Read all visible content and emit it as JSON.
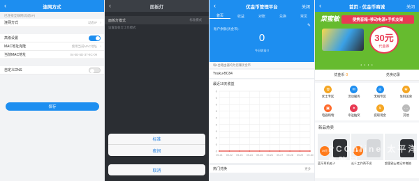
{
  "panel1": {
    "title": "连网方式",
    "hint": "已连接互联网(动态IP)",
    "connection": {
      "label": "连网方式",
      "value": "动态IP"
    },
    "advanced": {
      "label": "高级设置",
      "on": true
    },
    "mac_clone": {
      "label": "MAC地址克隆",
      "value": "使用当前MAC地址"
    },
    "mac_current": {
      "label": "当前MAC地址",
      "value": "04-0E-5D-37-8C-09"
    },
    "custom_dns": {
      "label": "自定义DNS",
      "on": false
    },
    "save_label": "保存"
  },
  "panel2": {
    "title": "面板灯",
    "mode": {
      "label": "面板灯模式",
      "value": "标准模式"
    },
    "hint": "设置面板灯工作模式",
    "options": [
      "标准",
      "夜间"
    ],
    "cancel_label": "取消"
  },
  "panel3": {
    "title": "优金币管理平台",
    "close_label": "关闭",
    "tabs": [
      "首页",
      "收益",
      "对账",
      "兑换",
      "常见"
    ],
    "balance_label": "账户余额(优金币):",
    "balance_value": "0",
    "balance_sub": "今日收益 0",
    "note": "每1台路由器均为您赚优金币",
    "device": "Youku-BC84",
    "chart_title": "最近10天收益",
    "hot_label": "热门兑换",
    "more_label": "更多"
  },
  "panel4": {
    "title": "首页 - 优金币商城",
    "close_label": "关闭",
    "banner": {
      "brand": "菜蜜敏",
      "tagline": "便携音箱+移动电源+手机支架",
      "coupon_value": "30元",
      "coupon_unit": "代金券"
    },
    "coin_label": "优金币",
    "coin_value": "0",
    "exchange_label": "兑换记录",
    "grid": [
      {
        "label": "优土专区",
        "icon": "shield-icon",
        "color": "#f5a623",
        "glyph": "✿"
      },
      {
        "label": "活动服务",
        "icon": "chat-icon",
        "color": "#1d8ef0",
        "glyph": "✉"
      },
      {
        "label": "无线专区",
        "icon": "wifi-icon",
        "color": "#1d8ef0",
        "glyph": "◎"
      },
      {
        "label": "生鲜美食",
        "icon": "food-icon",
        "color": "#f5a623",
        "glyph": "❀"
      },
      {
        "label": "电器购物",
        "icon": "bag-icon",
        "color": "#ff6a2b",
        "glyph": "▣"
      },
      {
        "label": "幸运抽奖",
        "icon": "gift-icon",
        "color": "#e83a53",
        "glyph": "✦"
      },
      {
        "label": "提取现金",
        "icon": "cash-icon",
        "color": "#f5a623",
        "glyph": "¥"
      },
      {
        "label": "其他",
        "icon": "more-icon",
        "color": "#bbbbbb",
        "glyph": "⋯"
      }
    ],
    "new_label": "新品热卖",
    "products": [
      {
        "name": "蓝牙耳机帽子",
        "price": "39元"
      },
      {
        "name": "娱乐工作两不误",
        "price": "38元"
      },
      {
        "name": "超值锐士笔记本电脑",
        "price": ""
      }
    ],
    "watermark": "PCOnline 太平洋电脑网"
  },
  "chart_data": {
    "type": "line",
    "title": "最近10天收益",
    "x": [
      "09-21",
      "09-22",
      "09-23",
      "09-24",
      "09-25",
      "09-26",
      "09-27",
      "09-28",
      "09-29",
      "09-30"
    ],
    "series": [
      {
        "values": [
          0,
          0,
          0,
          0,
          0,
          0,
          0,
          0,
          0,
          0
        ],
        "color": "#e8453c"
      }
    ],
    "yticks": [
      0,
      0,
      0,
      0,
      0,
      0,
      0,
      0,
      0,
      0
    ],
    "ylim": [
      0,
      1
    ],
    "grid": true
  }
}
